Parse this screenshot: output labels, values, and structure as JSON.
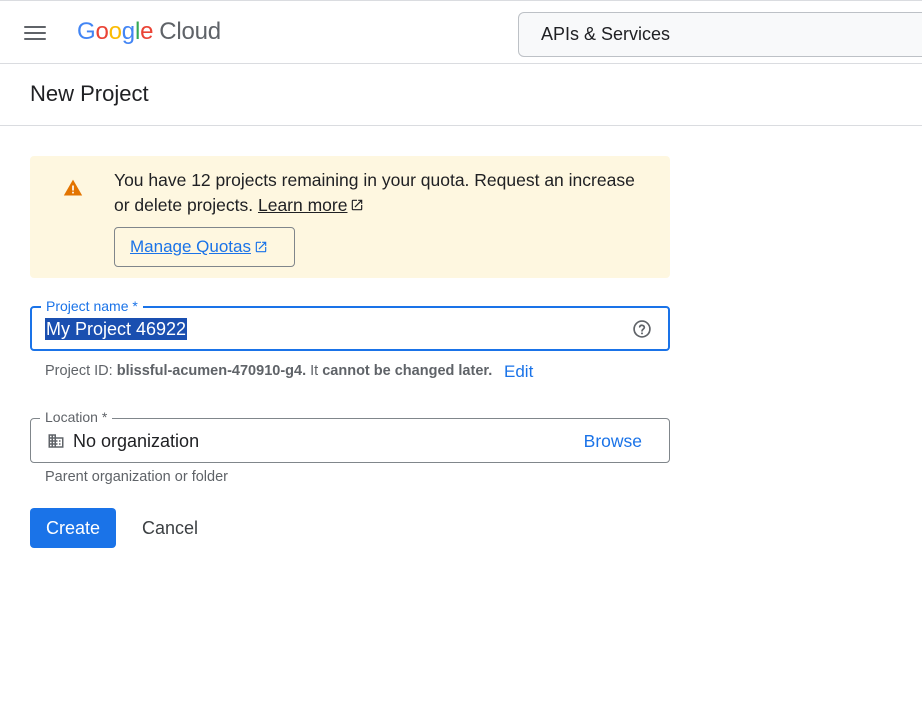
{
  "header": {
    "logo_google": [
      "G",
      "o",
      "o",
      "g",
      "l",
      "e"
    ],
    "logo_cloud": "Cloud",
    "search_value": "APIs & Services"
  },
  "page": {
    "title": "New Project"
  },
  "quota_banner": {
    "message": "You have 12 projects remaining in your quota. Request an increase or delete projects.",
    "learn_more": "Learn more",
    "manage_quotas": "Manage Quotas"
  },
  "project_name_field": {
    "label": "Project name *",
    "value": "My Project 46922"
  },
  "project_id_line": {
    "prefix": "Project ID: ",
    "id": "blissful-acumen-470910-g4.",
    "middle": " It ",
    "emphasis": "cannot be changed later.",
    "edit": "Edit"
  },
  "location_field": {
    "label": "Location *",
    "value": "No organization",
    "browse": "Browse",
    "hint": "Parent organization or folder"
  },
  "actions": {
    "create": "Create",
    "cancel": "Cancel"
  },
  "colors": {
    "accent": "#1a73e8",
    "warning": "#e37400",
    "banner_bg": "#fef7e0",
    "google_blue": "#4285f4",
    "google_red": "#ea4335",
    "google_yellow": "#fbbc04",
    "google_green": "#34a853"
  },
  "icons": {
    "menu": "hamburger-menu-icon",
    "warning": "warning-triangle-icon",
    "external_link": "open-in-new-icon",
    "help": "help-circle-icon",
    "organization": "domain-building-icon"
  }
}
